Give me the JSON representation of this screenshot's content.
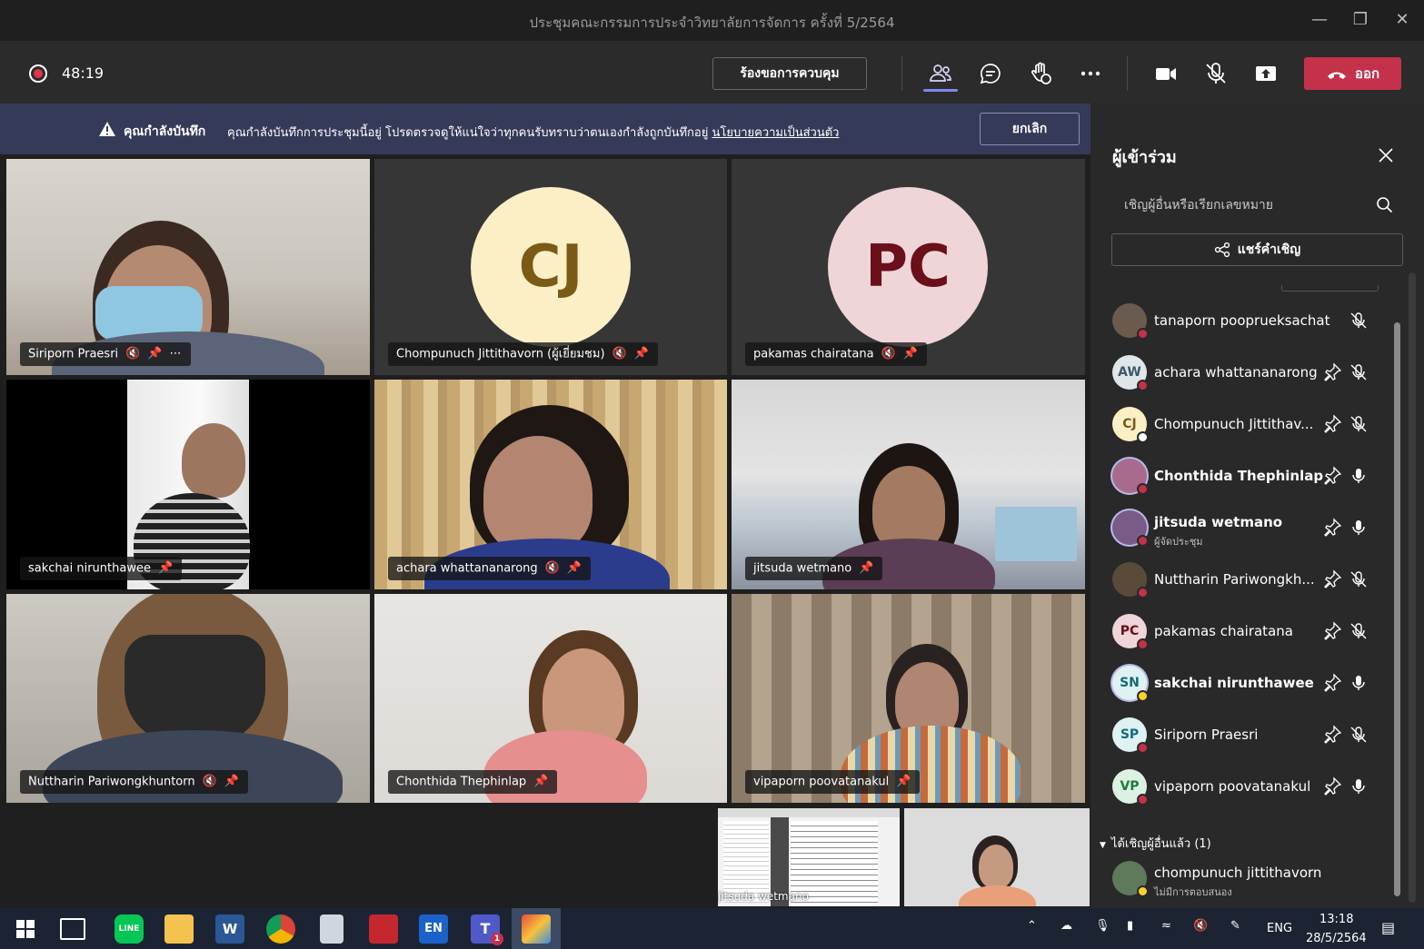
{
  "window": {
    "title": "ประชุมคณะกรรมการประจำวิทยาลัยการจัดการ ครั้งที่ 5/2564"
  },
  "toolbar": {
    "timer": "48:19",
    "request_control_label": "ร้องขอการควบคุม",
    "leave_label": "ออก"
  },
  "banner": {
    "title": "คุณกำลังบันทึก",
    "text": "คุณกำลังบันทึกการประชุมนี้อยู่ โปรดตรวจดูให้แน่ใจว่าทุกคนรับทราบว่าตนเองกำลังถูกบันทึกอยู่",
    "link": "นโยบายความเป็นส่วนตัว",
    "cancel_label": "ยกเลิก"
  },
  "tiles": [
    {
      "name": "Siriporn Praesri"
    },
    {
      "name": "Chompunuch Jittithavorn (ผู้เยี่ยมชม)",
      "initials": "CJ"
    },
    {
      "name": "pakamas chairatana",
      "initials": "PC"
    },
    {
      "name": "sakchai nirunthawee"
    },
    {
      "name": "achara whattananarong"
    },
    {
      "name": "jitsuda wetmano"
    },
    {
      "name": "Nuttharin Pariwongkhuntorn"
    },
    {
      "name": "Chonthida Thephinlap"
    },
    {
      "name": "vipaporn poovatanakul"
    },
    {
      "name": "jitsuda wetmano"
    }
  ],
  "panel": {
    "title": "ผู้เข้าร่วม",
    "search_placeholder": "เชิญผู้อื่นหรือเรียกเลขหมาย",
    "share_label": "แชร์คำเชิญ",
    "participants": [
      {
        "name": "tanaporn pooprueksachat",
        "initials": "",
        "sub": ""
      },
      {
        "name": "achara whattananarong",
        "initials": "AW",
        "sub": ""
      },
      {
        "name": "Chompunuch Jittithav...",
        "initials": "CJ",
        "sub": ""
      },
      {
        "name": "Chonthida Thephinlap",
        "initials": "",
        "sub": ""
      },
      {
        "name": "jitsuda wetmano",
        "initials": "",
        "sub": "ผู้จัดประชุม"
      },
      {
        "name": "Nuttharin Pariwongkh...",
        "initials": "",
        "sub": ""
      },
      {
        "name": "pakamas chairatana",
        "initials": "PC",
        "sub": ""
      },
      {
        "name": "sakchai nirunthawee",
        "initials": "SN",
        "sub": ""
      },
      {
        "name": "Siriporn Praesri",
        "initials": "SP",
        "sub": ""
      },
      {
        "name": "vipaporn poovatanakul",
        "initials": "VP",
        "sub": ""
      }
    ],
    "invited_section": "ได้เชิญผู้อื่นแล้ว (1)",
    "invited": {
      "name": "chompunuch jittithavorn",
      "sub": "ไม่มีการตอบสนอง"
    }
  },
  "taskbar": {
    "lang": "ENG",
    "time": "13:18",
    "date": "28/5/2564",
    "teams_badge": "1"
  }
}
